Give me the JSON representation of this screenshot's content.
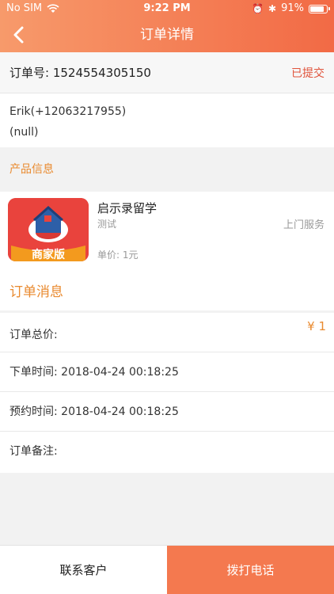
{
  "status_bar": {
    "carrier": "No SIM",
    "time": "9:22 PM",
    "battery": "91%",
    "battery_level": 0.91
  },
  "nav": {
    "title": "订单详情"
  },
  "order": {
    "number_label": "订单号:",
    "number": "1524554305150",
    "status": "已提交"
  },
  "customer": {
    "name_phone": "Erik(+12063217955)",
    "address": "(null)"
  },
  "product_section": {
    "title": "产品信息"
  },
  "product": {
    "name": "启示录留学",
    "tag": "测试",
    "service": "上门服务",
    "price": "单价: 1元",
    "badge": "商家版"
  },
  "message_section": {
    "title": "订单消息"
  },
  "details": {
    "total_label": "订单总价:",
    "total_price": "¥ 1",
    "order_time": "下单时间: 2018-04-24 00:18:25",
    "appointment_time": "预约时间: 2018-04-24 00:18:25",
    "remark": "订单备注:"
  },
  "actions": {
    "contact": "联系客户",
    "call": "拨打电话"
  },
  "colors": {
    "accent": "#f26a45",
    "orange_text": "#e98a2f",
    "status_red": "#e0533b",
    "call_button": "#f4794f"
  }
}
